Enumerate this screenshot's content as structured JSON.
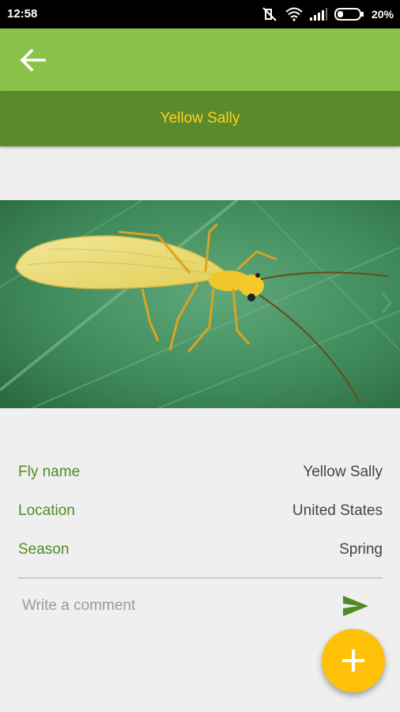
{
  "status_bar": {
    "time": "12:58",
    "battery_percent": "20%",
    "icons": [
      "mute-icon",
      "wifi-icon",
      "signal-icon",
      "battery-icon"
    ]
  },
  "app_bar": {
    "back_icon": "arrow-left-icon",
    "color": "#8bc34a"
  },
  "title_band": {
    "title": "Yellow Sally",
    "color": "#5a8a2b",
    "text_color": "#ffd21f"
  },
  "details": {
    "rows": [
      {
        "label": "Fly name",
        "value": "Yellow Sally"
      },
      {
        "label": "Location",
        "value": "United States"
      },
      {
        "label": "Season",
        "value": "Spring"
      }
    ]
  },
  "comment": {
    "placeholder": "Write a comment",
    "value": "",
    "send_icon": "send-icon"
  },
  "fab": {
    "icon": "plus-icon",
    "color": "#ffc107"
  }
}
